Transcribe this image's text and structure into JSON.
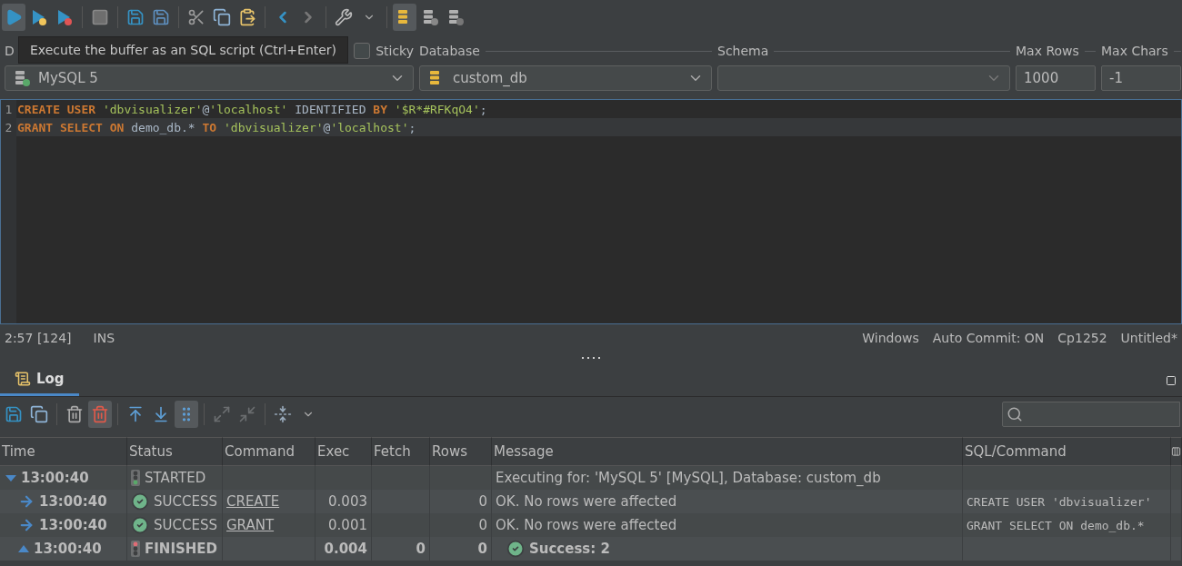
{
  "toolbar": [
    [
      {
        "kind": "run",
        "pressed": true
      },
      {
        "kind": "run-current",
        "pressed": false
      },
      {
        "kind": "run-selection",
        "pressed": false
      }
    ],
    [
      {
        "kind": "stop",
        "pressed": false
      }
    ],
    [
      {
        "kind": "save",
        "pressed": false
      },
      {
        "kind": "save-as",
        "pressed": false
      }
    ],
    [
      {
        "kind": "cut",
        "pressed": false
      },
      {
        "kind": "copy",
        "pressed": false
      },
      {
        "kind": "paste",
        "pressed": false
      }
    ],
    [
      {
        "kind": "back",
        "pressed": false
      },
      {
        "kind": "forward",
        "pressed": false
      }
    ],
    [
      {
        "kind": "tools",
        "pressed": false
      },
      {
        "kind": "dropdown",
        "pressed": false
      }
    ],
    [
      {
        "kind": "buffer-run",
        "pressed": true
      },
      {
        "kind": "buffer-save",
        "pressed": false
      },
      {
        "kind": "buffer-load",
        "pressed": false
      }
    ]
  ],
  "tooltip": "Execute the buffer as an SQL script (Ctrl+Enter)",
  "connection_bar": {
    "connection_label": "D",
    "sticky": {
      "label": "Sticky",
      "checked": false
    },
    "database_label": "Database",
    "schema_label": "Schema",
    "max_rows_label": "Max Rows",
    "max_chars_label": "Max Chars",
    "connection": "MySQL 5",
    "database": "custom_db",
    "max_rows": "1000",
    "max_chars": "-1"
  },
  "editor": {
    "lines": [
      {
        "number": "1",
        "current": false,
        "tokens": [
          {
            "kind": "keyword",
            "text": "CREATE USER"
          },
          {
            "kind": "string",
            "text": " 'dbvisualizer'"
          },
          {
            "kind": "plain",
            "text": "@"
          },
          {
            "kind": "string",
            "text": "'localhost'"
          },
          {
            "kind": "plain",
            "text": " IDENTIFIED "
          },
          {
            "kind": "keyword",
            "text": "BY"
          },
          {
            "kind": "string",
            "text": " '$R*#RFKqO4'"
          },
          {
            "kind": "plain",
            "text": ";"
          }
        ]
      },
      {
        "number": "2",
        "current": true,
        "tokens": [
          {
            "kind": "keyword",
            "text": "GRANT SELECT ON"
          },
          {
            "kind": "plain",
            "text": " demo_db.* "
          },
          {
            "kind": "keyword",
            "text": "TO"
          },
          {
            "kind": "string",
            "text": " 'dbvisualizer'"
          },
          {
            "kind": "plain",
            "text": "@"
          },
          {
            "kind": "string",
            "text": "'localhost'"
          },
          {
            "kind": "plain",
            "text": ";"
          }
        ]
      }
    ]
  },
  "status_bar": {
    "position": "2:57 [124]",
    "mode": "INS",
    "items": [
      "Windows",
      "Auto Commit: ON",
      "Cp1252",
      "Untitled*"
    ]
  },
  "log_panel": {
    "tab": {
      "label": "Log",
      "selected": true
    },
    "toolbar": [
      [
        {
          "kind": "save",
          "pressed": false
        },
        {
          "kind": "copy",
          "pressed": false
        }
      ],
      [
        {
          "kind": "delete",
          "pressed": false
        },
        {
          "kind": "delete-marked",
          "pressed": true
        }
      ],
      [
        {
          "kind": "to-top",
          "pressed": false
        },
        {
          "kind": "to-bottom",
          "pressed": false
        },
        {
          "kind": "follow",
          "pressed": true
        }
      ],
      [
        {
          "kind": "expand-all",
          "pressed": false
        },
        {
          "kind": "collapse-all",
          "pressed": false
        }
      ],
      [
        {
          "kind": "fit",
          "pressed": false
        },
        {
          "kind": "dropdown",
          "pressed": false
        }
      ]
    ],
    "columns": [
      "Time",
      "Status",
      "Command",
      "Exec",
      "Fetch",
      "Rows",
      "Message",
      "SQL/Command"
    ],
    "rows": [
      {
        "kind": "started",
        "time": "13:00:40",
        "status": "STARTED",
        "message": "Executing for: 'MySQL 5' [MySQL], Database: custom_db",
        "expanded": true,
        "children": [
          {
            "kind": "success",
            "time": "13:00:40",
            "status": "SUCCESS",
            "command": "CREATE",
            "exec": "0.003",
            "rows": "0",
            "message": "OK. No rows were affected",
            "sql": "CREATE USER 'dbvisualizer'"
          },
          {
            "kind": "success",
            "time": "13:00:40",
            "status": "SUCCESS",
            "command": "GRANT",
            "exec": "0.001",
            "rows": "0",
            "message": "OK. No rows were affected",
            "sql": "GRANT SELECT ON demo_db.*"
          },
          {
            "kind": "finished",
            "time": "13:00:40",
            "status": "FINISHED",
            "exec": "0.004",
            "fetch": "0",
            "rows": "0",
            "message": "Success: 2"
          }
        ]
      }
    ]
  }
}
